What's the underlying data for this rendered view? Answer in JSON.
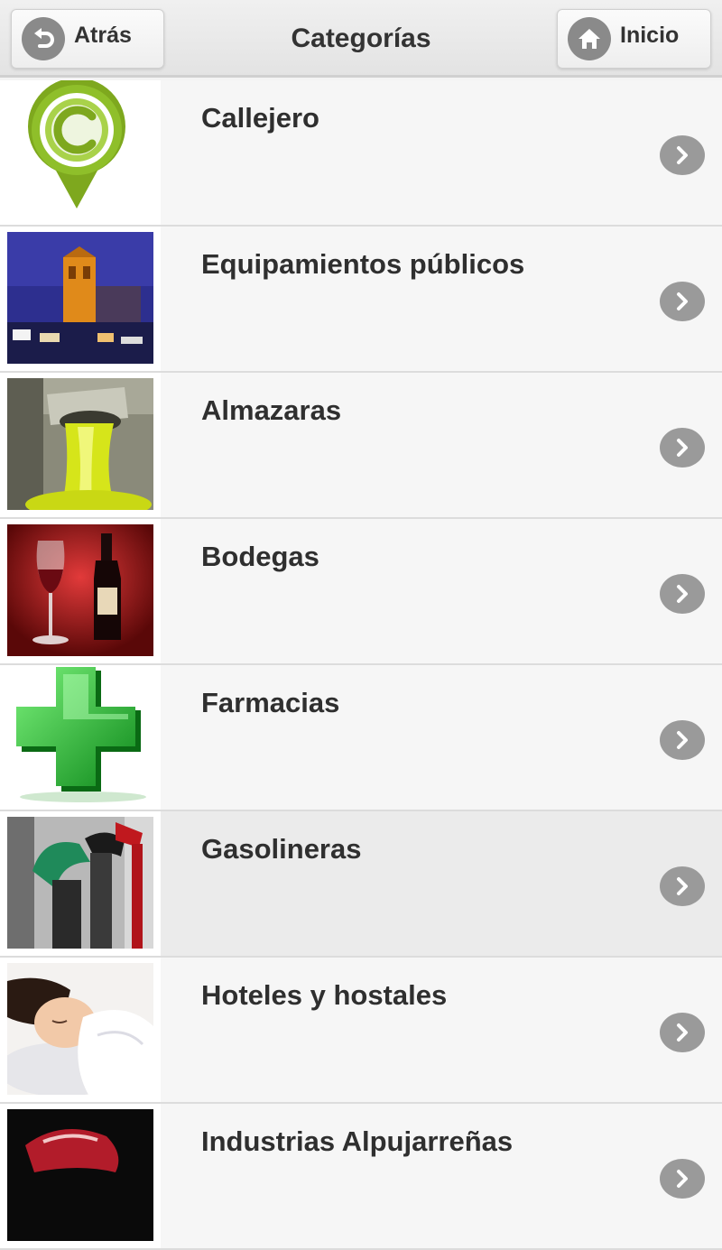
{
  "header": {
    "title": "Categorías",
    "back_label": "Atrás",
    "home_label": "Inicio"
  },
  "categories": [
    {
      "label": "Callejero",
      "icon": "map-pin-c-logo"
    },
    {
      "label": "Equipamientos públicos",
      "icon": "church-tower-night-photo"
    },
    {
      "label": "Almazaras",
      "icon": "olive-oil-pouring-photo"
    },
    {
      "label": "Bodegas",
      "icon": "wine-glass-bottle-photo"
    },
    {
      "label": "Farmacias",
      "icon": "green-pharmacy-cross"
    },
    {
      "label": "Gasolineras",
      "icon": "fuel-pump-nozzles-photo"
    },
    {
      "label": "Hoteles y hostales",
      "icon": "sleeping-woman-photo"
    },
    {
      "label": "Industrias Alpujarreñas",
      "icon": "ham-slices-photo"
    }
  ],
  "colors": {
    "header_bg": "#e8e8e8",
    "row_bg": "#f6f6f6",
    "row_active_bg": "#ebebeb",
    "chevron": "#9a9a9a",
    "text": "#2f2f2f"
  }
}
